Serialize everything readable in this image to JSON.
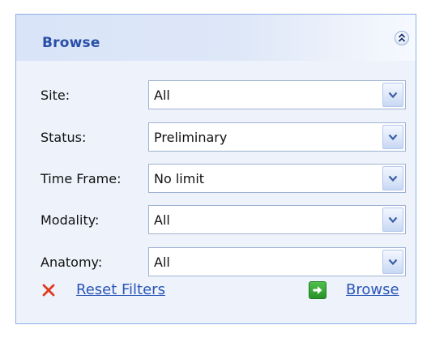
{
  "panel": {
    "title": "Browse",
    "collapse_icon": "double-chevron-up-icon"
  },
  "filters": [
    {
      "label": "Site:",
      "value": "All"
    },
    {
      "label": "Status:",
      "value": "Preliminary"
    },
    {
      "label": "Time Frame:",
      "value": "No limit"
    },
    {
      "label": "Modality:",
      "value": "All"
    },
    {
      "label": "Anatomy:",
      "value": "All"
    }
  ],
  "actions": {
    "reset_label": "Reset Filters",
    "reset_icon": "x-icon",
    "browse_label": "Browse",
    "browse_icon": "arrow-right-icon"
  },
  "colors": {
    "accent": "#2a4fa6",
    "link": "#2a55b8",
    "reset_icon": "#e03a1e",
    "browse_icon": "#2f9a2f"
  }
}
